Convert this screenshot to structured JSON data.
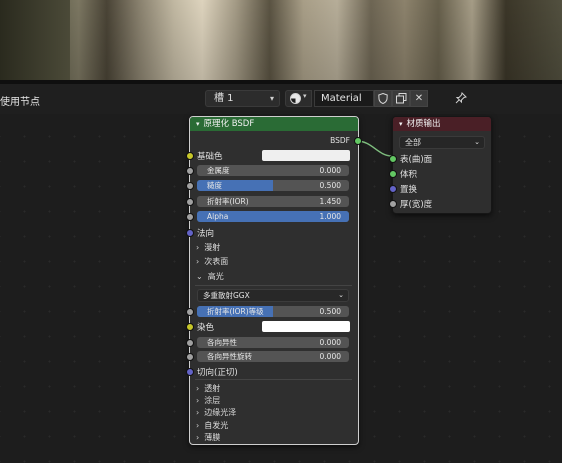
{
  "header": {
    "left_text": "使用节点",
    "slot_label": "槽 1",
    "material_name": "Material",
    "icons": [
      "material-sphere-icon",
      "fake-user-shield-icon",
      "duplicate-icon",
      "close-icon",
      "pin-icon"
    ]
  },
  "bsdf_node": {
    "title": "原理化 BSDF",
    "output_label": "BSDF",
    "base_color_label": "基础色",
    "metallic": {
      "label": "金属度",
      "value": "0.000"
    },
    "roughness": {
      "label": "糙度",
      "value": "0.500",
      "fraction": 0.5
    },
    "ior": {
      "label": "折射率(IOR)",
      "value": "1.450"
    },
    "alpha": {
      "label": "Alpha",
      "value": "1.000",
      "fraction": 1.0
    },
    "normal_label": "法向",
    "sub_panels_top": [
      "漫射",
      "次表面"
    ],
    "specular_panel": "高光",
    "distribution": "多重散射GGX",
    "ior_level": {
      "label": "折射率(IOR)等级",
      "value": "0.500",
      "fraction": 0.5
    },
    "tint_label": "染色",
    "anisotropic": {
      "label": "各向异性",
      "value": "0.000"
    },
    "anisotropic_rotation": {
      "label": "各向异性旋转",
      "value": "0.000"
    },
    "tangent_label": "切向(正切)",
    "sub_panels_bottom": [
      "透射",
      "涂层",
      "边缘光泽",
      "自发光",
      "薄膜"
    ]
  },
  "output_node": {
    "title": "材质输出",
    "target": "全部",
    "inputs": [
      "表(曲)面",
      "体积",
      "置换",
      "厚(宽)度"
    ]
  },
  "colors": {
    "bsdf_header": "#2a6b35",
    "output_header": "#4a1f26",
    "slider_fill": "#4671b5",
    "socket_yellow": "#c7c729",
    "socket_gray": "#a1a1a1",
    "socket_blue": "#6363c7",
    "socket_green": "#63c763"
  }
}
